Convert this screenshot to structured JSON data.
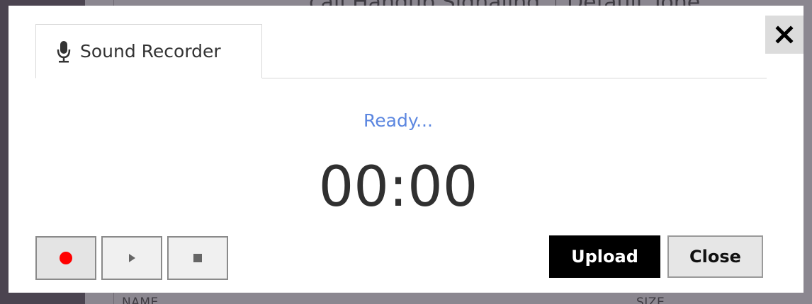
{
  "background": {
    "header_left_fragment": "call Hangup Signaling",
    "header_right_fragment": "Default Tone",
    "column_name": "NAME",
    "column_size": "SIZE"
  },
  "dialog": {
    "tab_label": "Sound Recorder",
    "status_text": "Ready...",
    "timer": "00:00",
    "upload_label": "Upload",
    "close_label": "Close",
    "close_icon_glyph": "✕"
  },
  "icons": {
    "tab_icon": "microphone-icon",
    "record": "record-icon",
    "play": "play-icon",
    "stop": "stop-icon",
    "close": "close-icon"
  },
  "colors": {
    "status": "#5b86e0",
    "record_dot": "#ff0000",
    "upload_bg": "#000000"
  }
}
